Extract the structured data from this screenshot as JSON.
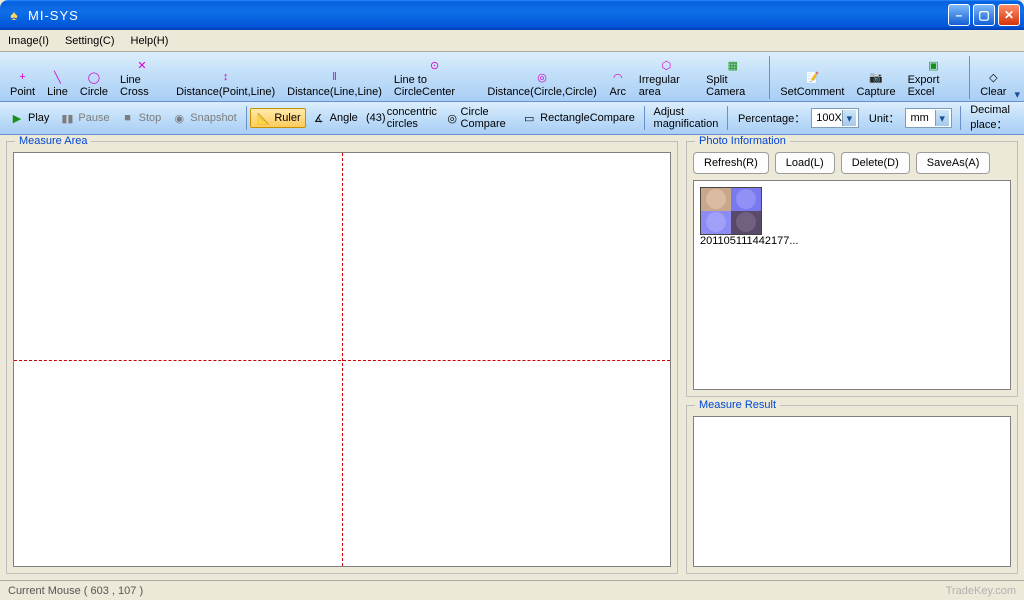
{
  "title": "MI-SYS",
  "menu": {
    "image": "Image(I)",
    "setting": "Setting(C)",
    "help": "Help(H)"
  },
  "toolbar_main": {
    "point": "Point",
    "line": "Line",
    "circle": "Circle",
    "linecross": "Line Cross",
    "dist_pl": "Distance(Point,Line)",
    "dist_ll": "Distance(Line,Line)",
    "line_cc": "Line to CircleCenter",
    "dist_cc": "Distance(Circle,Circle)",
    "arc": "Arc",
    "irregular": "Irregular area",
    "split": "Split Camera",
    "setcomment": "SetComment",
    "capture": "Capture",
    "exportexcel": "Export Excel",
    "clear": "Clear"
  },
  "toolbar_sub": {
    "play": "Play",
    "pause": "Pause",
    "stop": "Stop",
    "snapshot": "Snapshot",
    "ruler": "Ruler",
    "angle": "Angle",
    "concentric_sym": "(43)",
    "concentric": "concentric circles",
    "circle_compare": "Circle Compare",
    "rect_compare": "RectangleCompare",
    "adjust_mag": "Adjust magnification",
    "percentage_label": "Percentage：",
    "percentage_value": "100X",
    "unit_label": "Unit：",
    "unit_value": "mm",
    "decimal_label": "Decimal place："
  },
  "left_panel": {
    "legend": "Measure Area"
  },
  "photo_info": {
    "legend": "Photo Information",
    "refresh": "Refresh(R)",
    "load": "Load(L)",
    "delete": "Delete(D)",
    "saveas": "SaveAs(A)",
    "thumb_label": "201105111442177..."
  },
  "measure_result": {
    "legend": "Measure Result"
  },
  "status": {
    "mouse": "Current Mouse ( 603 , 107 )",
    "watermark": "TradeKey.com"
  }
}
